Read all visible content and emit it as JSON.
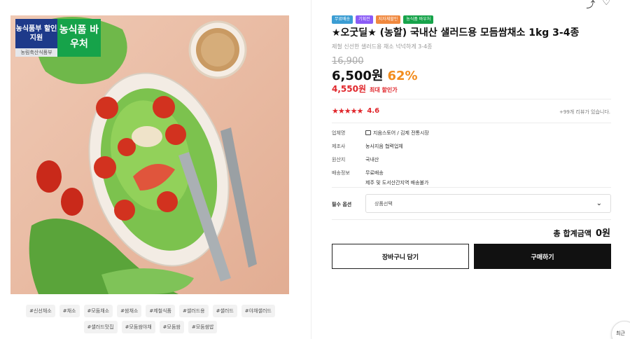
{
  "image": {
    "voucher_left": "농식품부 할인지원",
    "voucher_right": "농식품 바우처",
    "voucher_sub": "농림축산식품부"
  },
  "tags": [
    "#신선채소",
    "#채소",
    "#모둠채소",
    "#쌈채소",
    "#제철식품",
    "#샐러드용",
    "#샐러드",
    "#야채샐러드",
    "#샐러드맛집",
    "#모둠쌈야채",
    "#모둠쌈",
    "#모둠쌈밥"
  ],
  "badges": [
    {
      "label": "무료배송",
      "color": "#3b9dd3"
    },
    {
      "label": "기획전",
      "color": "#8b5cf6"
    },
    {
      "label": "지자체할인",
      "color": "#f0883e"
    },
    {
      "label": "농식품 바우처",
      "color": "#16a34a"
    }
  ],
  "product": {
    "title": "★오굿딜★ (농할) 국내산 샐러드용 모듬쌈채소 1kg 3-4종",
    "subtitle": "제철 신선한 샐러드용 채소 넉넉하게 3-4종",
    "original_price": "16,900",
    "sale_price": "6,500원",
    "discount": "62%",
    "max_price": "4,550원",
    "max_label": "최대 할인가",
    "stars": "★★★★★",
    "rating": "4.6",
    "rating_value": 4.6,
    "review_text": "+99개 리뷰가 있습니다."
  },
  "info": {
    "seller_key": "업체명",
    "seller_val": "지음스토어 / 김제 전통시장",
    "maker_key": "제조사",
    "maker_val": "농사지음 협력업체",
    "origin_key": "원산지",
    "origin_val": "국내산",
    "delivery_key": "배송정보",
    "delivery_val": "무료배송",
    "delivery_val2": "제주 및 도서산간지역 배송불가"
  },
  "option": {
    "label": "필수 옵션",
    "placeholder": "상품선택"
  },
  "total": {
    "label": "총 합계금액",
    "value": "0원"
  },
  "buttons": {
    "cart": "장바구니 담기",
    "buy": "구매하기",
    "recent": "최근"
  },
  "icons": {
    "share": "share-icon",
    "wishlist": "heart-icon",
    "chevron": "chevron-down-icon"
  }
}
